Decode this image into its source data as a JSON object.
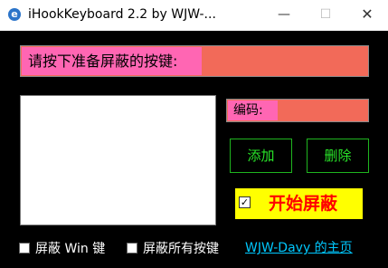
{
  "titlebar": {
    "title": "iHookKeyboard 2.2 by WJW-...",
    "app_icon": "app-e-icon",
    "minimize": "—",
    "maximize": "☐",
    "close": "✕"
  },
  "key_prompt": {
    "label": "请按下准备屏蔽的按键:",
    "value": ""
  },
  "key_list": {
    "items": []
  },
  "code": {
    "label": "编码:",
    "value": ""
  },
  "buttons": {
    "add": "添加",
    "delete": "删除",
    "start": "开始屏蔽"
  },
  "start_checked_mark": "✓",
  "options": {
    "block_win_key": "屏蔽 Win 键",
    "block_all_keys": "屏蔽所有按键"
  },
  "homepage_link": "WJW-Davy 的主页",
  "colors": {
    "background": "#000000",
    "label_pink": "#ff66b3",
    "value_salmon": "#f26a59",
    "button_green": "#29e629",
    "start_yellow": "#ffff00",
    "start_red": "#ff0000",
    "link_cyan": "#00c8ff"
  }
}
